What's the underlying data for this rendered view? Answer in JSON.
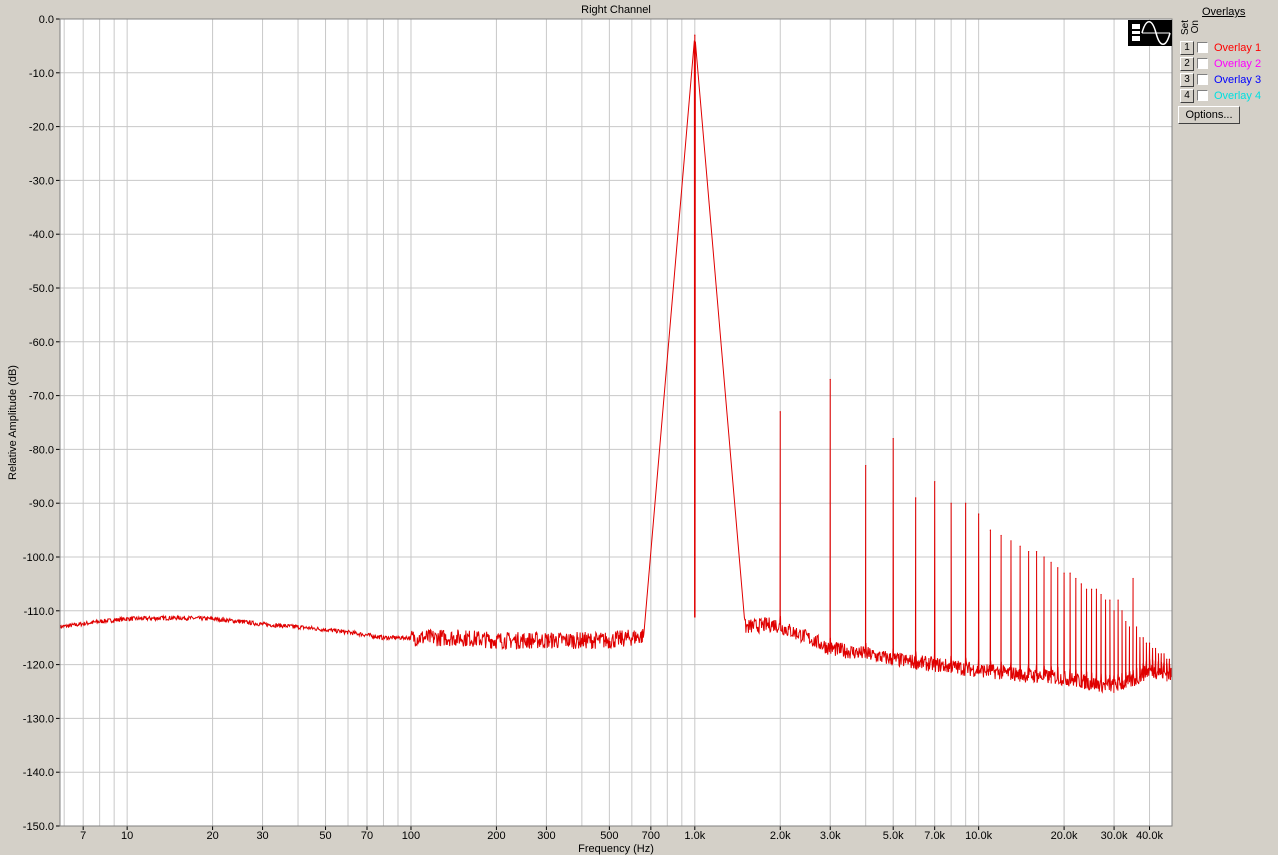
{
  "chart_data": {
    "type": "line",
    "title": "Right Channel",
    "xlabel": "Frequency (Hz)",
    "ylabel": "Relative Amplitude (dB)",
    "x_scale": "log",
    "xlim": [
      5.8,
      48000
    ],
    "ylim": [
      -150,
      0
    ],
    "grid": true,
    "yticks": [
      0,
      -10,
      -20,
      -30,
      -40,
      -50,
      -60,
      -70,
      -80,
      -90,
      -100,
      -110,
      -120,
      -130,
      -140,
      -150
    ],
    "ytick_labels": [
      "0.0",
      "-10.0",
      "-20.0",
      "-30.0",
      "-40.0",
      "-50.0",
      "-60.0",
      "-70.0",
      "-80.0",
      "-90.0",
      "-100.0",
      "-110.0",
      "-120.0",
      "-130.0",
      "-140.0",
      "-150.0"
    ],
    "xticks": [
      7,
      10,
      20,
      30,
      50,
      70,
      100,
      200,
      300,
      500,
      700,
      1000,
      2000,
      3000,
      5000,
      7000,
      10000,
      20000,
      30000,
      40000
    ],
    "xtick_labels": [
      "7",
      "10",
      "20",
      "30",
      "50",
      "70",
      "100",
      "200",
      "300",
      "500",
      "700",
      "1.0k",
      "2.0k",
      "3.0k",
      "5.0k",
      "7.0k",
      "10.0k",
      "20.0k",
      "30.0k",
      "40.0k"
    ],
    "series": [
      {
        "color": "#e00000",
        "noise_floor": {
          "x": [
            5.8,
            8,
            10,
            15,
            20,
            25,
            30,
            40,
            50,
            60,
            70,
            80,
            100,
            150,
            200,
            300,
            500,
            700,
            850,
            1200,
            1500,
            1900,
            2500,
            3000,
            4000,
            5000,
            7000,
            10000,
            15000,
            20000,
            25000,
            30000,
            35000,
            40000,
            48000
          ],
          "y": [
            -113,
            -112,
            -111.5,
            -111.3,
            -111.5,
            -112,
            -112.5,
            -113,
            -113.5,
            -114,
            -114.5,
            -115,
            -115,
            -115,
            -115.5,
            -115.5,
            -115.5,
            -114.5,
            -113,
            -113.5,
            -113,
            -112.5,
            -115,
            -117,
            -118,
            -119,
            -120,
            -121,
            -122,
            -122.5,
            -123.5,
            -124,
            -123,
            -121,
            -122
          ]
        },
        "peaks": {
          "x": [
            1000,
            2000,
            3000,
            4000,
            5000,
            6000,
            7000,
            8000,
            9000,
            10000,
            11000,
            12000,
            13000,
            14000,
            15000,
            16000,
            17000,
            18000,
            19000,
            20000,
            21000,
            22000,
            23000,
            24000,
            25000,
            26000,
            27000,
            28000,
            29000,
            30000,
            31000,
            32000,
            33000,
            34000,
            35000,
            36000,
            37000,
            38000,
            39000,
            40000,
            41000,
            42000,
            43000,
            44000,
            45000,
            46000,
            47000
          ],
          "y": [
            -3,
            -73,
            -67,
            -83,
            -78,
            -89,
            -86,
            -90,
            -90,
            -92,
            -95,
            -96,
            -97,
            -98,
            -99,
            -99,
            -100,
            -101,
            -102,
            -103,
            -103,
            -104,
            -105,
            -106,
            -106,
            -106,
            -107,
            -108,
            -108,
            -110,
            -108,
            -110,
            -112,
            -113,
            -104,
            -113,
            -115,
            -115,
            -116,
            -116,
            -117,
            -117,
            -118,
            -118,
            -118,
            -119,
            -119
          ]
        }
      }
    ]
  },
  "overlays": {
    "title": "Overlays",
    "set_label": "Set",
    "on_label": "On",
    "items": [
      {
        "num": "1",
        "label": "Overlay 1",
        "color": "#ff0000"
      },
      {
        "num": "2",
        "label": "Overlay 2",
        "color": "#ff00ff"
      },
      {
        "num": "3",
        "label": "Overlay 3",
        "color": "#0000ff"
      },
      {
        "num": "4",
        "label": "Overlay 4",
        "color": "#00e0e0"
      }
    ],
    "options_label": "Options..."
  }
}
